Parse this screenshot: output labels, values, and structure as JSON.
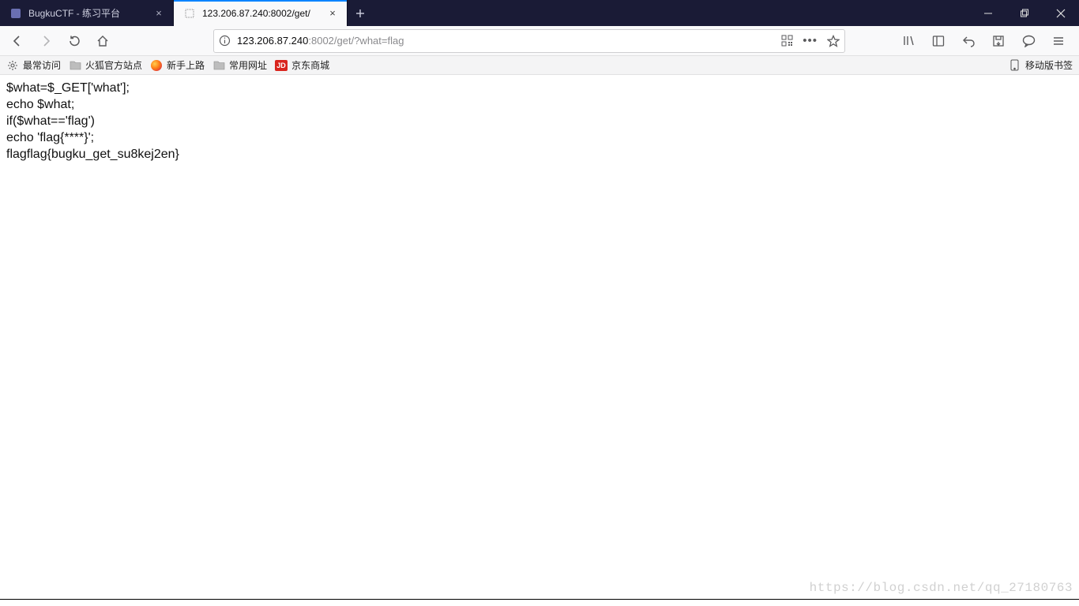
{
  "window": {
    "tabs": [
      {
        "title": "BugkuCTF - 练习平台",
        "active": false
      },
      {
        "title": "123.206.87.240:8002/get/",
        "active": true
      }
    ]
  },
  "nav": {
    "url_host": "123.206.87.240",
    "url_port_path": ":8002/get/",
    "url_query": "?what=flag"
  },
  "bookmarks": {
    "most_visited": "最常访问",
    "items": [
      {
        "label": "火狐官方站点",
        "type": "folder"
      },
      {
        "label": "新手上路",
        "type": "firefox"
      },
      {
        "label": "常用网址",
        "type": "folder"
      },
      {
        "label": "京东商城",
        "type": "jd"
      }
    ],
    "mobile": "移动版书签"
  },
  "page": {
    "lines": [
      "$what=$_GET['what'];",
      "echo $what;",
      "if($what=='flag')",
      "echo 'flag{****}';",
      "flagflag{bugku_get_su8kej2en}"
    ]
  },
  "watermark": "https://blog.csdn.net/qq_27180763"
}
